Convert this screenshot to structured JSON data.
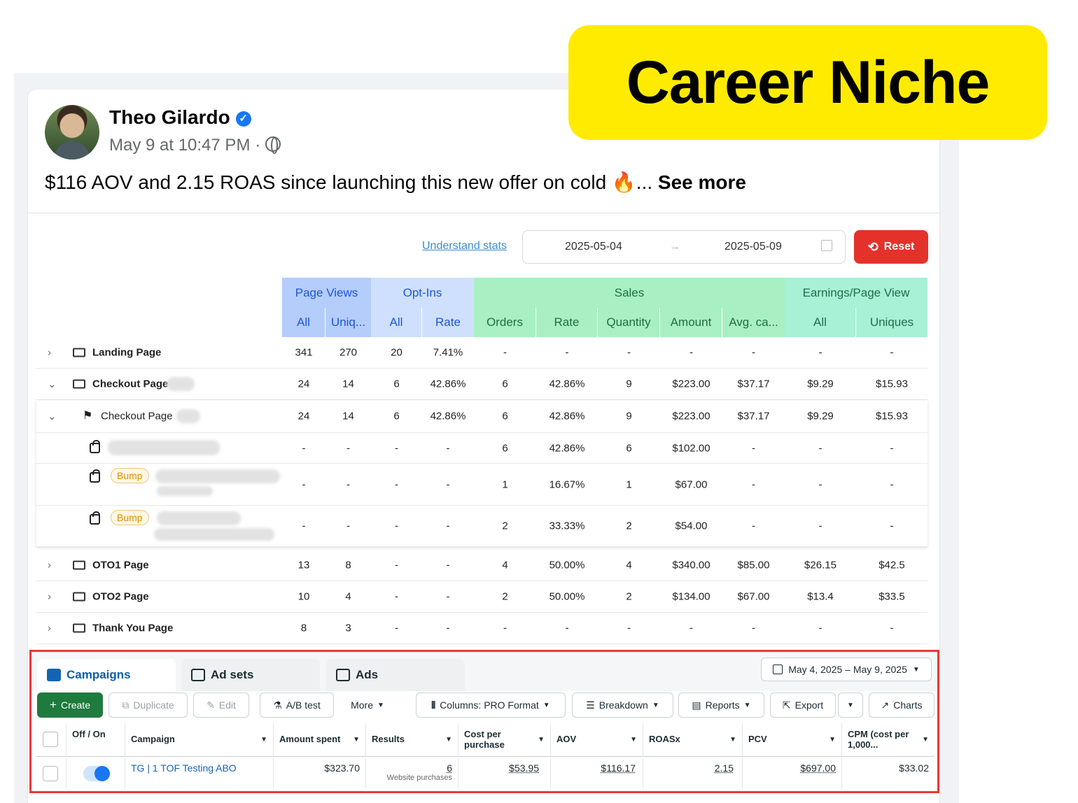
{
  "sticker": {
    "label": "Career Niche"
  },
  "post": {
    "author": "Theo Gilardo",
    "timestamp": "May 9 at 10:47 PM ·",
    "text": "$116 AOV and 2.15 ROAS since launching this new offer on cold ",
    "emoji": "🔥",
    "ellipsis": "... ",
    "see_more": "See more"
  },
  "stats_toolbar": {
    "understand_link": "Understand stats",
    "date_start": "2025-05-04",
    "arrow": "→",
    "date_end": "2025-05-09",
    "reset_label": "Reset"
  },
  "funnel_table": {
    "groups": [
      "Page Views",
      "Opt-Ins",
      "Sales",
      "Earnings/Page View"
    ],
    "columns": [
      "All",
      "Uniq...",
      "All",
      "Rate",
      "Orders",
      "Rate",
      "Quantity",
      "Amount",
      "Avg. ca...",
      "All",
      "Uniques"
    ],
    "rows": [
      {
        "name": "Landing Page",
        "values": [
          "341",
          "270",
          "20",
          "7.41%",
          "-",
          "-",
          "-",
          "-",
          "-",
          "-",
          "-"
        ]
      },
      {
        "name": "Checkout Page",
        "values": [
          "24",
          "14",
          "6",
          "42.86%",
          "6",
          "42.86%",
          "9",
          "$223.00",
          "$37.17",
          "$9.29",
          "$15.93"
        ]
      },
      {
        "name": "Checkout Page",
        "values": [
          "24",
          "14",
          "6",
          "42.86%",
          "6",
          "42.86%",
          "9",
          "$223.00",
          "$37.17",
          "$9.29",
          "$15.93"
        ]
      },
      {
        "name": "",
        "values": [
          "-",
          "-",
          "-",
          "-",
          "6",
          "42.86%",
          "6",
          "$102.00",
          "-",
          "-",
          "-"
        ]
      },
      {
        "name": "",
        "badge": "Bump",
        "values": [
          "-",
          "-",
          "-",
          "-",
          "1",
          "16.67%",
          "1",
          "$67.00",
          "-",
          "-",
          "-"
        ]
      },
      {
        "name": "",
        "badge": "Bump",
        "values": [
          "-",
          "-",
          "-",
          "-",
          "2",
          "33.33%",
          "2",
          "$54.00",
          "-",
          "-",
          "-"
        ]
      },
      {
        "name": "OTO1 Page",
        "values": [
          "13",
          "8",
          "-",
          "-",
          "4",
          "50.00%",
          "4",
          "$340.00",
          "$85.00",
          "$26.15",
          "$42.5"
        ]
      },
      {
        "name": "OTO2 Page",
        "values": [
          "10",
          "4",
          "-",
          "-",
          "2",
          "50.00%",
          "2",
          "$134.00",
          "$67.00",
          "$13.4",
          "$33.5"
        ]
      },
      {
        "name": "Thank You Page",
        "values": [
          "8",
          "3",
          "-",
          "-",
          "-",
          "-",
          "-",
          "-",
          "-",
          "-",
          "-"
        ]
      }
    ]
  },
  "ads_manager": {
    "tabs": [
      "Campaigns",
      "Ad sets",
      "Ads"
    ],
    "date_range": "May 4, 2025 – May 9, 2025",
    "toolbar": [
      "Create",
      "Duplicate",
      "Edit",
      "A/B test",
      "More",
      "Columns: PRO Format",
      "Breakdown",
      "Reports",
      "Export",
      "Charts"
    ],
    "headers": [
      "Off / On",
      "Campaign",
      "Amount spent",
      "Results",
      "Cost per purchase",
      "AOV",
      "ROASx",
      "PCV",
      "CPM (cost per 1,000..."
    ],
    "row": {
      "campaign": "TG | 1 TOF Testing ABO",
      "amount_spent": "$323.70",
      "results": "6",
      "results_sub": "Website purchases",
      "cost_per_purchase": "$53.95",
      "aov": "$116.17",
      "roas": "2.15",
      "pcv": "$697.00",
      "cpm": "$33.02"
    }
  }
}
